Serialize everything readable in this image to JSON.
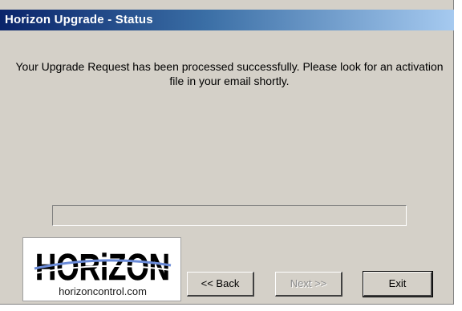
{
  "window": {
    "title": "Horizon Upgrade - Status"
  },
  "status": {
    "message": "Your Upgrade Request has been processed successfully. Please look for an activation file in your email shortly."
  },
  "progress": {
    "value": 0
  },
  "logo": {
    "brand": "HORiZON",
    "url": "horizoncontrol.com"
  },
  "buttons": {
    "back_label": "<< Back",
    "next_label": "Next >>",
    "exit_label": "Exit"
  }
}
